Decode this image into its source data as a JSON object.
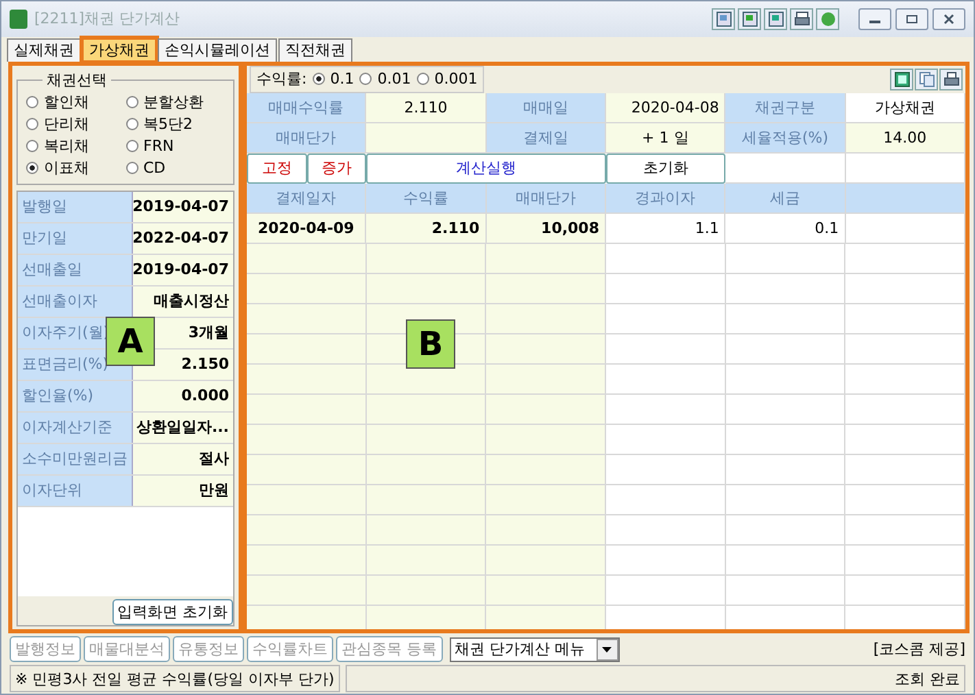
{
  "window": {
    "title": "[2211]채권 단가계산"
  },
  "tabs": [
    {
      "label": "실제채권",
      "selected": false,
      "outlined": false
    },
    {
      "label": "가상채권",
      "selected": true,
      "outlined": true
    },
    {
      "label": "손익시뮬레이션",
      "selected": false,
      "outlined": false
    },
    {
      "label": "직전채권",
      "selected": false,
      "outlined": false
    }
  ],
  "bond_select": {
    "title": "채권선택",
    "options": [
      {
        "label": "할인채",
        "selected": false
      },
      {
        "label": "분할상환",
        "selected": false
      },
      {
        "label": "단리채",
        "selected": false
      },
      {
        "label": "복5단2",
        "selected": false
      },
      {
        "label": "복리채",
        "selected": false
      },
      {
        "label": "FRN",
        "selected": false
      },
      {
        "label": "이표채",
        "selected": true
      },
      {
        "label": "CD",
        "selected": false
      }
    ]
  },
  "info_rows": [
    {
      "label": "발행일",
      "value": "2019-04-07"
    },
    {
      "label": "만기일",
      "value": "2022-04-07"
    },
    {
      "label": "선매출일",
      "value": "2019-04-07"
    },
    {
      "label": "선매출이자",
      "value": "매출시정산"
    },
    {
      "label": "이자주기(월)",
      "value": "3개월"
    },
    {
      "label": "표면금리(%)",
      "value": "2.150"
    },
    {
      "label": "할인율(%)",
      "value": "0.000"
    },
    {
      "label": "이자계산기준",
      "value": "상환일일자..."
    },
    {
      "label": "소수미만원리금",
      "value": "절사"
    },
    {
      "label": "이자단위",
      "value": "만원"
    }
  ],
  "reset_button": "입력화면 초기화",
  "yield_precision": {
    "label": "수익률:",
    "options": [
      {
        "label": "0.1",
        "selected": true
      },
      {
        "label": "0.01",
        "selected": false
      },
      {
        "label": "0.001",
        "selected": false
      }
    ]
  },
  "form_rows": [
    [
      {
        "label": "매매수익률",
        "value": "2.110",
        "editable": true
      },
      {
        "label": "매매일",
        "value": "2020-04-08",
        "editable": true
      },
      {
        "label": "채권구분",
        "value": "가상채권",
        "editable": false
      }
    ],
    [
      {
        "label": "매매단가",
        "editable": true
      },
      {
        "label": "결제일",
        "value": "+ 1 일",
        "editable": true
      },
      {
        "label": "세율적용(%)",
        "value": "14.00",
        "editable": true
      }
    ]
  ],
  "actions": [
    {
      "label": "고정",
      "color": "#cc0000",
      "kind": "small"
    },
    {
      "label": "증가",
      "color": "#cc0000",
      "kind": "small"
    },
    {
      "label": "계산실행",
      "color": "#2020cc",
      "kind": "wide"
    },
    {
      "label": "초기화",
      "color": "#000000",
      "kind": "normal"
    }
  ],
  "table": {
    "columns": [
      "결제일자",
      "수익률",
      "매매단가",
      "경과이자",
      "세금"
    ],
    "rows": [
      [
        "2020-04-09",
        "2.110",
        "10,008",
        "1.1",
        "0.1"
      ]
    ]
  },
  "annotations": [
    {
      "label": "A"
    },
    {
      "label": "B"
    }
  ],
  "bottom_buttons": [
    {
      "label": "발행정보",
      "disabled": true
    },
    {
      "label": "매물대분석",
      "disabled": true
    },
    {
      "label": "유통정보",
      "disabled": true
    },
    {
      "label": "수익률차트",
      "disabled": true
    },
    {
      "label": "관심종목 등록",
      "disabled": true
    }
  ],
  "menu_dropdown": "채권 단가계산 메뉴",
  "provider": "[코스콤 제공]",
  "status_bar": {
    "message": "※ 민평3사 전일 평균 수익률(당일 이자부 단가)",
    "state": "조회 완료"
  }
}
